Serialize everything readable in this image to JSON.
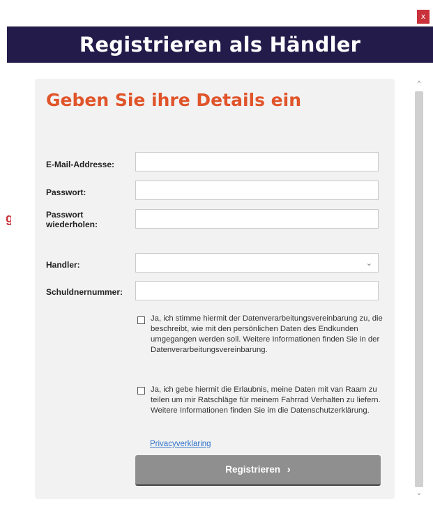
{
  "window": {
    "close_label": "x"
  },
  "header": {
    "title": "Registrieren als Händler"
  },
  "form": {
    "heading": "Geben Sie ihre Details ein",
    "fields": {
      "email_label": "E-Mail-Addresse:",
      "password_label": "Passwort:",
      "password_repeat_label": "Passwort wiederholen:",
      "dealer_label": "Handler:",
      "debtor_label": "Schuldnernummer:"
    },
    "consent_1": "Ja, ich stimme hiermit der Datenverarbeitungsvereinbarung zu, die beschreibt, wie mit den persönlichen Daten des Endkunden umgegangen werden soll. Weitere Informationen finden Sie in der Datenverarbeitungsvereinbarung.",
    "consent_2": "Ja, ich gebe hiermit die Erlaubnis, meine Daten mit van Raam zu teilen um mir Ratschläge für  meinem Fahrrad Verhalten zu liefern. Weitere Informationen finden Sie im die Datenschutzerklärung.",
    "privacy_link": "Privacyverklaring",
    "submit_label": "Registrieren",
    "submit_icon": "chevron-right-icon"
  },
  "colors": {
    "header": "#231c4a",
    "heading": "#e0542a",
    "close": "#c9313b",
    "button": "#8f8f8f",
    "link": "#2f72c9"
  }
}
